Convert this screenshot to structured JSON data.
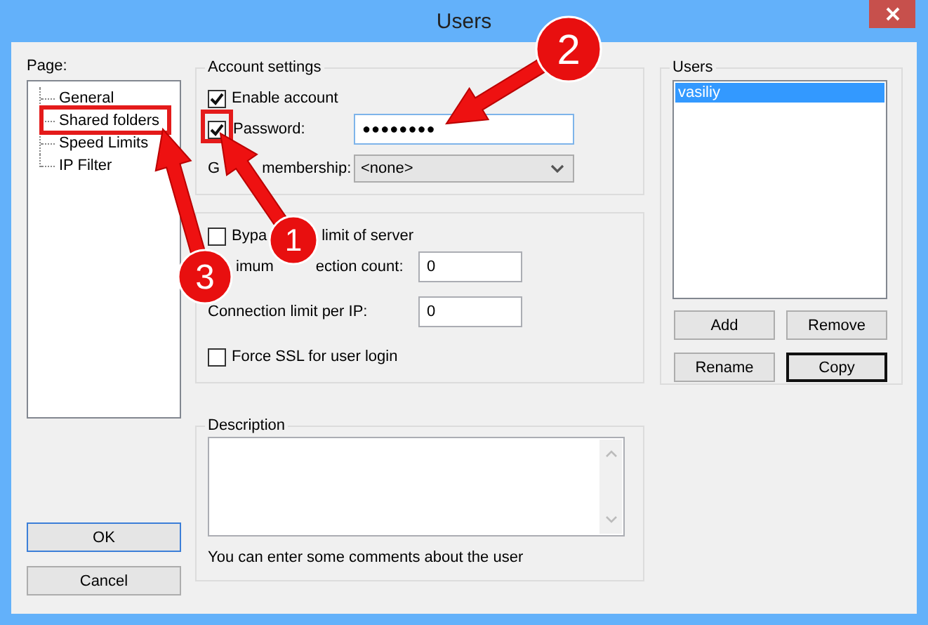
{
  "window": {
    "title": "Users"
  },
  "page_panel": {
    "label": "Page:",
    "tree": [
      {
        "label": "General"
      },
      {
        "label": "Shared folders"
      },
      {
        "label": "Speed Limits"
      },
      {
        "label": "IP Filter"
      }
    ]
  },
  "account_settings": {
    "title": "Account settings",
    "enable_account": {
      "label": "Enable account",
      "checked": true
    },
    "password": {
      "label": "Password:",
      "checked": true,
      "value": "●●●●●●●●"
    },
    "group_membership": {
      "label_parts": [
        "G",
        "membership:"
      ],
      "value": "<none>"
    }
  },
  "limits": {
    "bypass": {
      "label_parts": [
        "Bypa",
        "limit of server"
      ],
      "checked": false
    },
    "max_connections": {
      "label_parts": [
        "imum",
        "ection count:"
      ],
      "value": "0"
    },
    "per_ip": {
      "label": "Connection limit per IP:",
      "value": "0"
    },
    "force_ssl": {
      "label": "Force SSL for user login",
      "checked": false
    }
  },
  "description": {
    "title": "Description",
    "hint": "You can enter some comments about the user"
  },
  "users": {
    "title": "Users",
    "items": [
      {
        "name": "vasiliy",
        "selected": true
      }
    ],
    "buttons": [
      {
        "label": "Add",
        "default": false
      },
      {
        "label": "Remove",
        "default": false
      },
      {
        "label": "Rename",
        "default": false
      },
      {
        "label": "Copy",
        "default": true
      }
    ]
  },
  "dialog_buttons": [
    {
      "label": "OK",
      "focused": true
    },
    {
      "label": "Cancel",
      "focused": false
    }
  ],
  "annotations": [
    {
      "number": "1"
    },
    {
      "number": "2"
    },
    {
      "number": "3"
    }
  ]
}
